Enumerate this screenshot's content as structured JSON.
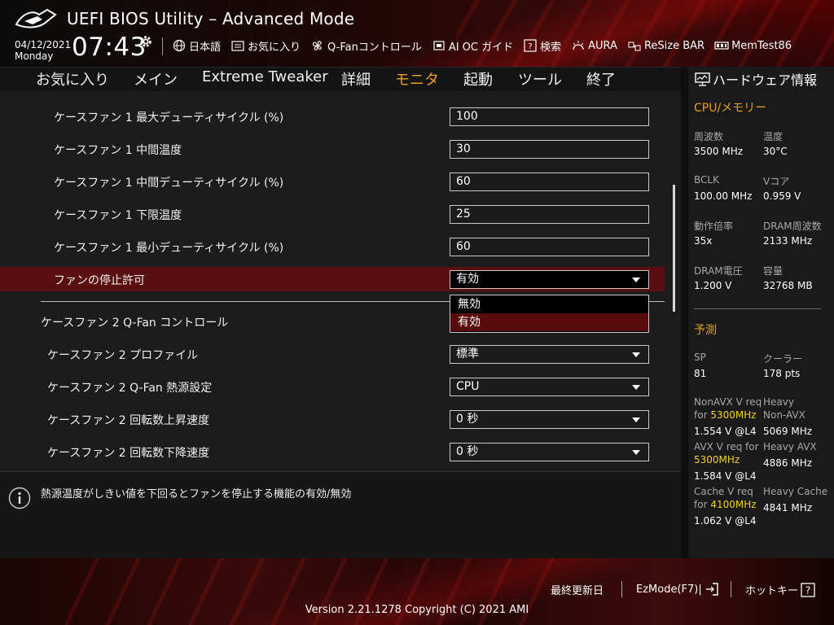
{
  "header": {
    "title": "UEFI BIOS Utility – Advanced Mode",
    "date": "04/12/2021",
    "weekday": "Monday",
    "time": "07:43",
    "tools": [
      {
        "label": "日本語",
        "icon": "globe-icon"
      },
      {
        "label": "お気に入り",
        "icon": "favorites-icon"
      },
      {
        "label": "Q-Fanコントロール",
        "icon": "fan-icon"
      },
      {
        "label": "AI OC ガイド",
        "icon": "ai-oc-icon"
      },
      {
        "label": "検索",
        "icon": "help-search-icon"
      },
      {
        "label": "AURA",
        "icon": "aura-icon"
      },
      {
        "label": "ReSize BAR",
        "icon": "resize-bar-icon"
      },
      {
        "label": "MemTest86",
        "icon": "memtest-icon"
      }
    ]
  },
  "menu": {
    "items": [
      "お気に入り",
      "メイン",
      "Extreme Tweaker",
      "詳細",
      "モニタ",
      "起動",
      "ツール",
      "終了"
    ],
    "active": "モニタ"
  },
  "settings": {
    "rows": [
      {
        "label": "ケースファン 1 最大デューティサイクル (%)",
        "value": "100"
      },
      {
        "label": "ケースファン 1 中間温度",
        "value": "30"
      },
      {
        "label": "ケースファン 1 中間デューティサイクル (%)",
        "value": "60"
      },
      {
        "label": "ケースファン 1 下限温度",
        "value": "25"
      },
      {
        "label": "ケースファン 1 最小デューティサイクル (%)",
        "value": "60"
      }
    ],
    "fan_stop": {
      "label": "ファンの停止許可",
      "value": "有効",
      "options": [
        "無効",
        "有効"
      ]
    },
    "section2_title": "ケースファン 2 Q-Fan コントロール",
    "rows2": [
      {
        "label": "ケースファン 2 プロファイル",
        "value": "標準"
      },
      {
        "label": "ケースファン 2 Q-Fan 熱源設定",
        "value": "CPU"
      },
      {
        "label": "ケースファン 2 回転数上昇速度",
        "value": "0 秒"
      },
      {
        "label": "ケースファン 2 回転数下降速度",
        "value": "0 秒"
      }
    ]
  },
  "help": {
    "text": "熱源温度がしきい値を下回るとファンを停止する機能の有効/無効"
  },
  "hw": {
    "title": "ハードウェア情報",
    "cpu_section": "CPU/メモリー",
    "cpu": [
      {
        "label": "周波数",
        "value": "3500 MHz"
      },
      {
        "label": "温度",
        "value": "30°C"
      },
      {
        "label": "BCLK",
        "value": "100.00 MHz"
      },
      {
        "label": "Vコア",
        "value": "0.959 V"
      },
      {
        "label": "動作倍率",
        "value": "35x"
      },
      {
        "label": "DRAM周波数",
        "value": "2133 MHz"
      },
      {
        "label": "DRAM電圧",
        "value": "1.200 V"
      },
      {
        "label": "容量",
        "value": "32768 MB"
      }
    ],
    "predict_section": "予測",
    "sp_label": "SP",
    "sp_value": "81",
    "cooler_label": "クーラー",
    "cooler_value": "178 pts",
    "nonavx_req_a": "NonAVX V req",
    "nonavx_req_b": "for",
    "nonavx_freq": "5300MHz",
    "nonavx_v": "1.554 V @L4",
    "heavy_nonavx_a": "Heavy",
    "heavy_nonavx_b": "Non-AVX",
    "heavy_nonavx_v": "5069 MHz",
    "avx_req_a": "AVX V req",
    "avx_req_b": "for",
    "avx_freq": "5300MHz",
    "avx_v": "1.584 V @L4",
    "heavy_avx": "Heavy AVX",
    "heavy_avx_v": "4886 MHz",
    "cache_req_a": "Cache V req",
    "cache_req_b": "for",
    "cache_freq": "4100MHz",
    "cache_v": "1.062 V @L4",
    "heavy_cache": "Heavy Cache",
    "heavy_cache_v": "4841 MHz"
  },
  "footer": {
    "last_updated": "最終更新日",
    "ezmode": "EzMode(F7)|",
    "hotkeys": "ホットキー",
    "version": "Version 2.21.1278 Copyright (C) 2021 AMI"
  },
  "colors": {
    "accent": "#e8a020",
    "highlight_row": "#5a1010",
    "predict_highlight": "#f0d020"
  }
}
